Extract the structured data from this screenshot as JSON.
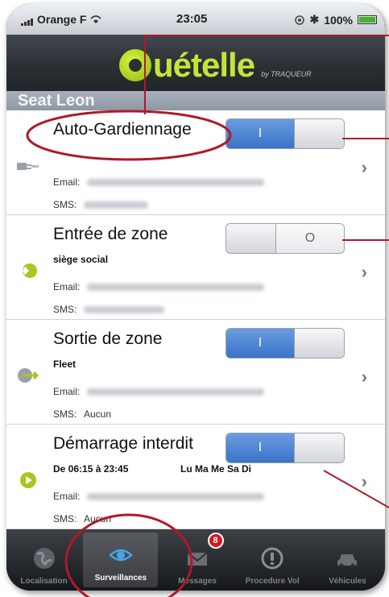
{
  "status_bar": {
    "carrier": "Orange F",
    "time": "23:05",
    "battery": "100%"
  },
  "header": {
    "logo_text": "uételle",
    "logo_by": "by TRAQUEUR"
  },
  "section_title": "Seat Leon",
  "rows": [
    {
      "title": "Auto-Gardiennage",
      "sub": "",
      "sub2": "",
      "email_label": "Email:",
      "sms_label": "SMS:",
      "sms_value": "",
      "toggle_state": "on",
      "toggle_on_label": "I",
      "toggle_off_label": "O",
      "icon": "plug-icon"
    },
    {
      "title": "Entrée de zone",
      "sub": "siège social",
      "sub2": "",
      "email_label": "Email:",
      "sms_label": "SMS:",
      "sms_value": "",
      "toggle_state": "off",
      "toggle_on_label": "I",
      "toggle_off_label": "O",
      "icon": "enter-zone-icon"
    },
    {
      "title": "Sortie de zone",
      "sub": "Fleet",
      "sub2": "",
      "email_label": "Email:",
      "sms_label": "SMS:",
      "sms_value": "Aucun",
      "toggle_state": "on",
      "toggle_on_label": "I",
      "toggle_off_label": "O",
      "icon": "exit-zone-icon"
    },
    {
      "title": "Démarrage interdit",
      "sub": "De 06:15 à 23:45",
      "sub2": "Lu Ma Me Sa Di",
      "email_label": "Email:",
      "sms_label": "SMS:",
      "sms_value": "Aucun",
      "toggle_state": "on",
      "toggle_on_label": "I",
      "toggle_off_label": "O",
      "icon": "play-icon"
    }
  ],
  "tabs": [
    {
      "label": "Localisation",
      "icon": "globe-icon",
      "active": false
    },
    {
      "label": "Surveillances",
      "icon": "eye-icon",
      "active": true
    },
    {
      "label": "Messages",
      "icon": "envelope-icon",
      "active": false,
      "badge": "8"
    },
    {
      "label": "Procedure Vol",
      "icon": "alert-icon",
      "active": false
    },
    {
      "label": "Véhicules",
      "icon": "car-icon",
      "active": false
    }
  ],
  "colors": {
    "accent_green": "#c5e43a",
    "toggle_blue": "#3a73c8",
    "annotation_red": "#b0182a",
    "badge_red": "#d8181f"
  }
}
